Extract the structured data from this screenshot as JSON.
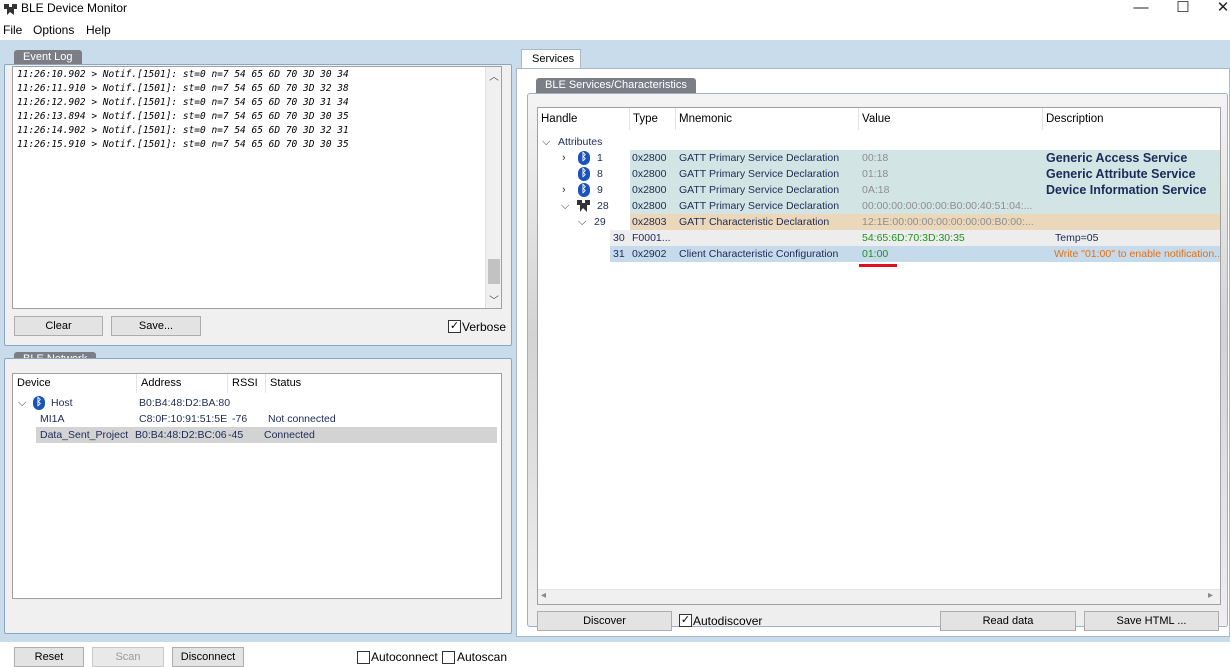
{
  "window": {
    "title": "BLE Device Monitor",
    "minimize": "—",
    "maximize": "☐",
    "close": "✕"
  },
  "menu": [
    "File",
    "Options",
    "Help"
  ],
  "event_log": {
    "group_title": "Event Log",
    "lines": [
      "11:26:10.902 > Notif.[1501]: st=0 n=7 54 65 6D 70 3D 30 34",
      "11:26:11.910 > Notif.[1501]: st=0 n=7 54 65 6D 70 3D 32 38",
      "11:26:12.902 > Notif.[1501]: st=0 n=7 54 65 6D 70 3D 31 34",
      "11:26:13.894 > Notif.[1501]: st=0 n=7 54 65 6D 70 3D 30 35",
      "11:26:14.902 > Notif.[1501]: st=0 n=7 54 65 6D 70 3D 32 31",
      "11:26:15.910 > Notif.[1501]: st=0 n=7 54 65 6D 70 3D 30 35"
    ],
    "clear_label": "Clear",
    "save_label": "Save...",
    "verbose_label": "Verbose",
    "verbose_checked": true
  },
  "network": {
    "group_title": "BLE Network",
    "columns": [
      "Device",
      "Address",
      "RSSI",
      "Status"
    ],
    "rows": [
      {
        "device": "Host",
        "address": "B0:B4:48:D2:BA:80",
        "rssi": "",
        "status": ""
      },
      {
        "device": "MI1A",
        "address": "C8:0F:10:91:51:5E",
        "rssi": "-76",
        "status": "Not connected"
      },
      {
        "device": "Data_Sent_Project",
        "address": "B0:B4:48:D2:BC:06",
        "rssi": "-45",
        "status": "Connected"
      }
    ],
    "reset_label": "Reset",
    "scan_label": "Scan",
    "disconnect_label": "Disconnect",
    "autoconnect_label": "Autoconnect",
    "autoscan_label": "Autoscan"
  },
  "services": {
    "tab_label": "Services",
    "group_title": "BLE Services/Characteristics",
    "columns": [
      "Handle",
      "Type",
      "Mnemonic",
      "Value",
      "Description"
    ],
    "root_label": "Attributes",
    "rows": [
      {
        "handle": "1",
        "type": "0x2800",
        "mnemonic": "GATT Primary Service Declaration",
        "value": "00:18",
        "description": "Generic Access Service"
      },
      {
        "handle": "8",
        "type": "0x2800",
        "mnemonic": "GATT Primary Service Declaration",
        "value": "01:18",
        "description": "Generic Attribute Service"
      },
      {
        "handle": "9",
        "type": "0x2800",
        "mnemonic": "GATT Primary Service Declaration",
        "value": "0A:18",
        "description": "Device Information Service"
      },
      {
        "handle": "28",
        "type": "0x2800",
        "mnemonic": "GATT Primary Service Declaration",
        "value": "00:00:00:00:00:00:B0:00:40:51:04:...",
        "description": ""
      },
      {
        "handle": "29",
        "type": "0x2803",
        "mnemonic": "GATT Characteristic Declaration",
        "value": "12:1E:00:00:00:00:00:00:00:B0:00:...",
        "description": ""
      },
      {
        "handle": "30",
        "type": "F0001...",
        "mnemonic": "",
        "value": "54:65:6D:70:3D:30:35",
        "description": "Temp=05"
      },
      {
        "handle": "31",
        "type": "0x2902",
        "mnemonic": "Client Characteristic Configuration",
        "value": "01:00",
        "description": "Write \"01:00\" to enable notification..."
      }
    ],
    "discover_label": "Discover",
    "autodiscover_label": "Autodiscover",
    "autodiscover_checked": true,
    "read_label": "Read data",
    "save_html_label": "Save HTML ..."
  },
  "colors": {
    "service_row_bg": "#d3e4e4",
    "characteristic_decl_bg": "#ebd8bb",
    "value_row_bg": "#ededed",
    "selected_row_bg": "#c5daea",
    "value_green": "#209020",
    "description_orange": "#e87012",
    "underline_red": "#e01020",
    "bluetooth_blue": "#1a54b8"
  }
}
